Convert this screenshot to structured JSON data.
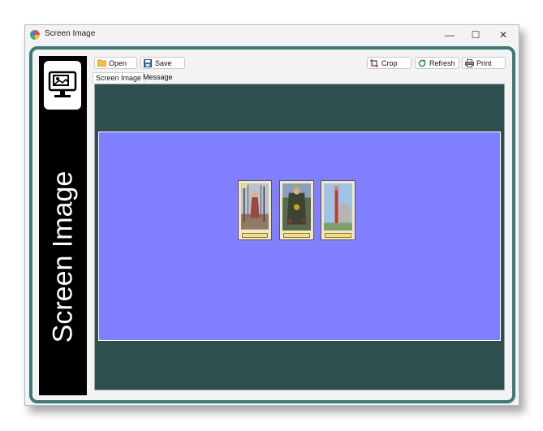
{
  "window": {
    "title": "Screen Image"
  },
  "sidebar": {
    "title": "Screen Image"
  },
  "toolbar": {
    "open_label": "Open",
    "save_label": "Save",
    "crop_label": "Crop",
    "refresh_label": "Refresh",
    "print_label": "Print"
  },
  "tabs": [
    {
      "label": "Screen Image",
      "active": true
    },
    {
      "label": "Message",
      "active": false
    }
  ],
  "cards": [
    {
      "name": "card-swords",
      "icon": "tarot-card-icon"
    },
    {
      "name": "card-king-of-coins",
      "icon": "tarot-card-icon"
    },
    {
      "name": "card-ace-of-wands",
      "icon": "tarot-card-icon"
    }
  ],
  "colors": {
    "frame": "#3c7a78",
    "view_background": "#2f4f4f",
    "canvas_background": "#7f7fff",
    "sidebar": "#000000"
  }
}
